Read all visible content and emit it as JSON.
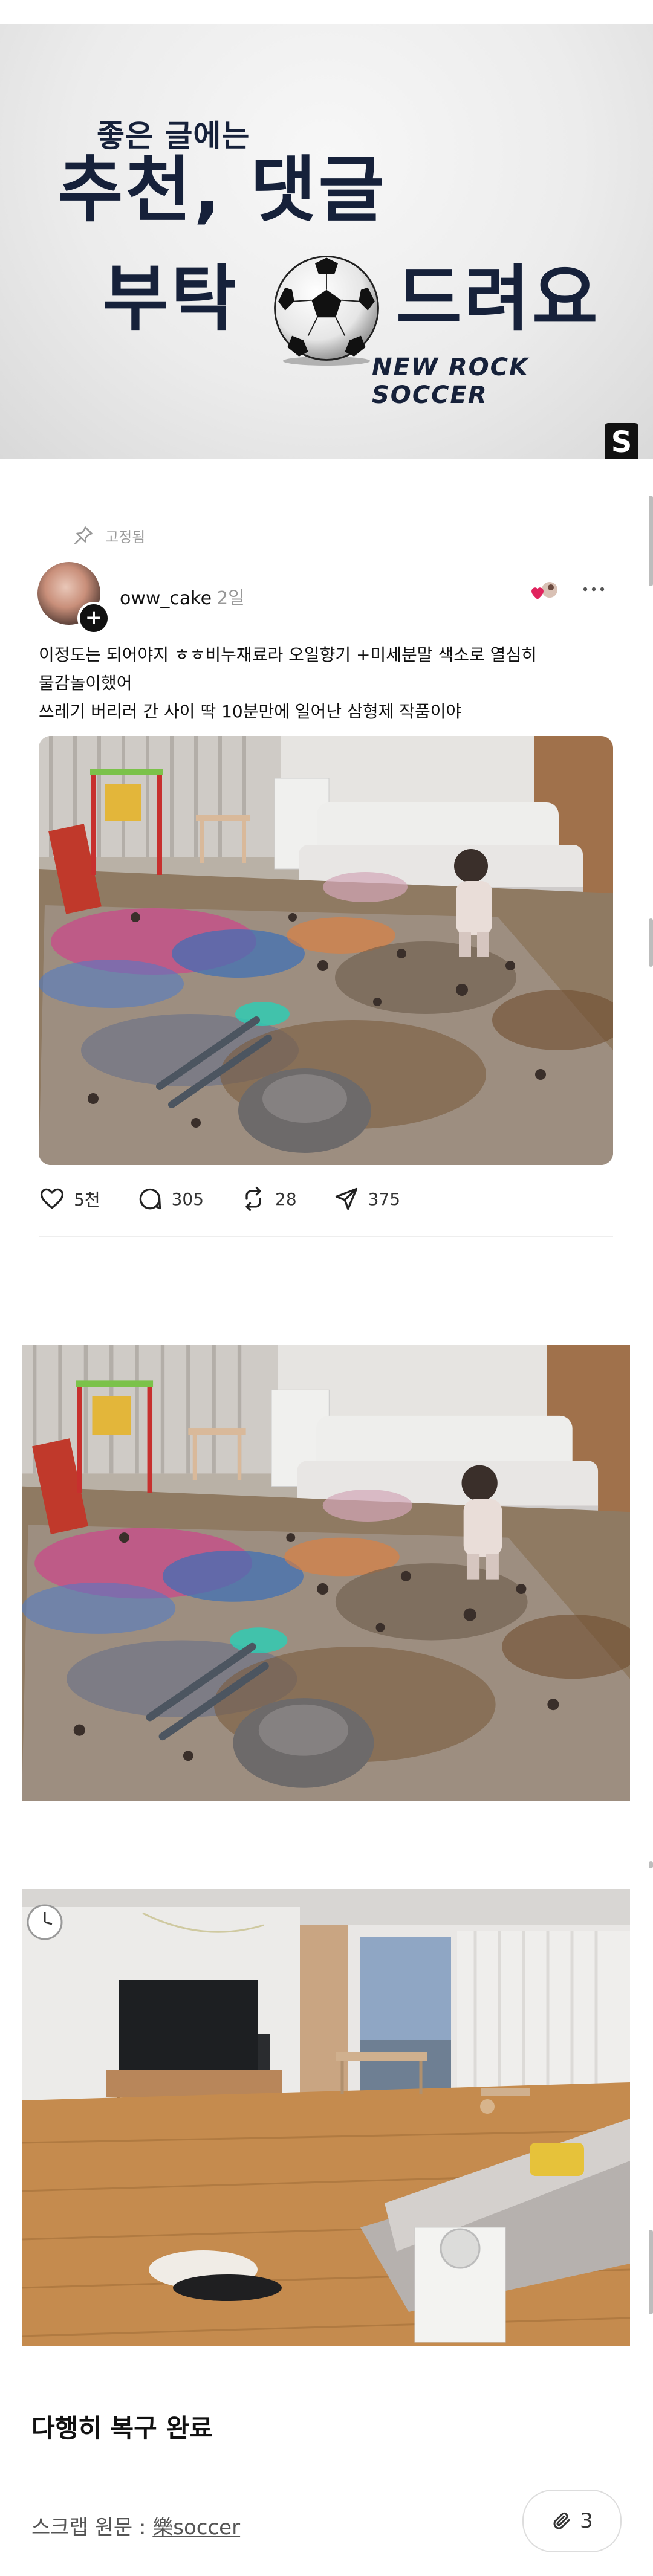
{
  "banner": {
    "small_text": "좋은 글에는",
    "line1": "추천, 댓글",
    "line2_left": "부탁",
    "line2_right": "드려요",
    "brand": "NEW ROCK SOCCER",
    "logo_letter": "S"
  },
  "post": {
    "pinned_label": "고정됨",
    "username": "oww_cake",
    "time": "2일",
    "text_lines": [
      "이정도는 되어야지 ㅎㅎ비누재료라 오일향기 +미세분말 색소로 열심히",
      "물감놀이했어",
      "쓰레기 버리러 간 사이 딱 10분만에 일어난 삼형제 작품이야"
    ],
    "actions": {
      "likes": "5천",
      "comments": "305",
      "reposts": "28",
      "shares": "375"
    }
  },
  "caption": "다행히 복구 완료",
  "scrap": {
    "label": "스크랩 원문 : ",
    "source": "樂soccer"
  },
  "clip_count": "3",
  "icons": [
    "pin-icon",
    "plus-icon",
    "more-icon",
    "heart-icon",
    "comment-icon",
    "repost-icon",
    "share-icon",
    "paperclip-icon"
  ],
  "colors": {
    "banner_text": "#16213a",
    "muted": "#999999",
    "like_red": "#e0245e"
  }
}
